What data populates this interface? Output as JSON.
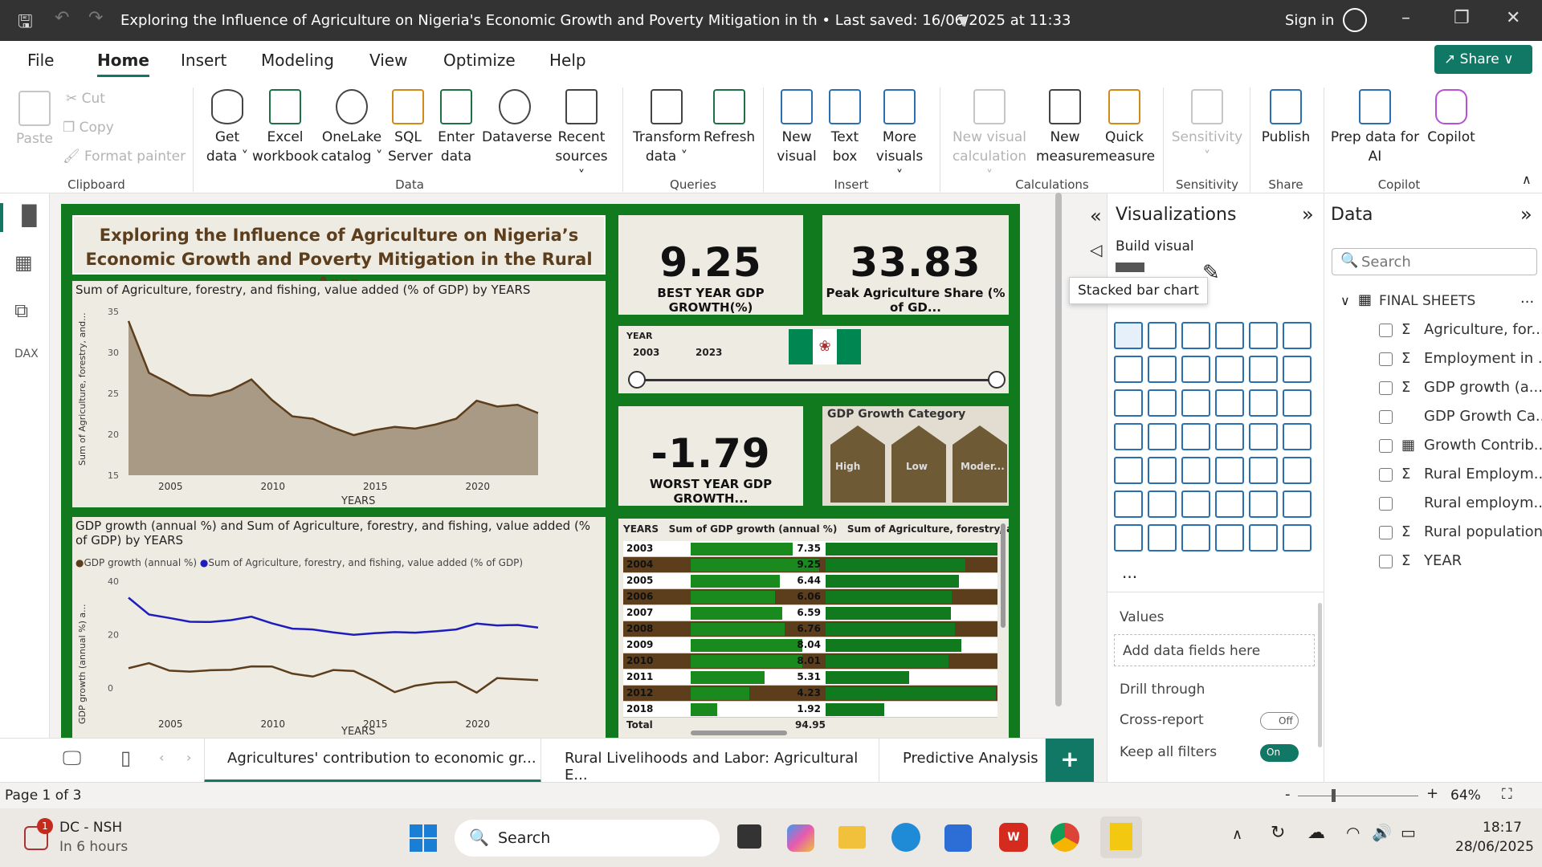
{
  "window": {
    "title": "Exploring the Influence of Agriculture on Nigeria's Economic Growth and Poverty Mitigation in th • Last saved: 16/06/2025 at 11:33",
    "sign_in": "Sign in"
  },
  "menu": {
    "tabs": [
      "File",
      "Home",
      "Insert",
      "Modeling",
      "View",
      "Optimize",
      "Help"
    ],
    "active": "Home",
    "share": "Share"
  },
  "ribbon": {
    "clipboard": {
      "paste": "Paste",
      "cut": "Cut",
      "copy": "Copy",
      "format_painter": "Format painter",
      "group": "Clipboard"
    },
    "data": {
      "get_data": [
        "Get",
        "data ˅"
      ],
      "excel": [
        "Excel",
        "workbook"
      ],
      "onelake": [
        "OneLake",
        "catalog ˅"
      ],
      "sql": [
        "SQL",
        "Server"
      ],
      "enter": [
        "Enter",
        "data"
      ],
      "dataverse": "Dataverse",
      "recent": [
        "Recent",
        "sources ˅"
      ],
      "group": "Data"
    },
    "queries": {
      "transform": [
        "Transform",
        "data ˅"
      ],
      "refresh": "Refresh",
      "group": "Queries"
    },
    "insert": {
      "new_visual": [
        "New",
        "visual"
      ],
      "text_box": [
        "Text",
        "box"
      ],
      "more_visuals": [
        "More",
        "visuals ˅"
      ],
      "group": "Insert"
    },
    "calculations": {
      "new_visual_calc": [
        "New visual",
        "calculation ˅"
      ],
      "new_measure": [
        "New",
        "measure"
      ],
      "quick_measure": [
        "Quick",
        "measure"
      ],
      "group": "Calculations"
    },
    "sensitivity": {
      "label": [
        "Sensitivity",
        "˅"
      ],
      "group": "Sensitivity"
    },
    "share": {
      "publish": "Publish",
      "group": "Share"
    },
    "copilot": {
      "prep": [
        "Prep data for",
        "AI"
      ],
      "copilot": "Copilot",
      "group": "Copilot"
    }
  },
  "report": {
    "title": "Exploring the Influence of Agriculture on Nigeria’s Economic Growth and Poverty Mitigation in the Rural Area",
    "kpi1": {
      "value": "9.25",
      "label": "BEST YEAR GDP GROWTH(%)"
    },
    "kpi2": {
      "value": "33.83",
      "label": "Peak Agriculture Share (% of GD..."
    },
    "kpi3": {
      "value": "-1.79",
      "label": "WORST YEAR GDP GROWTH..."
    },
    "slicer": {
      "label": "YEAR",
      "from": "2003",
      "to": "2023"
    },
    "category": {
      "title": "GDP Growth Category",
      "items": [
        "High",
        "Low",
        "Moder..."
      ]
    }
  },
  "chart_data": [
    {
      "type": "area",
      "title": "Sum of Agriculture, forestry, and fishing, value added (% of GDP) by YEARS",
      "xlabel": "YEARS",
      "ylabel": "Sum of Agriculture, forestry, and...",
      "x": [
        2003,
        2004,
        2005,
        2006,
        2007,
        2008,
        2009,
        2010,
        2011,
        2012,
        2013,
        2014,
        2015,
        2016,
        2017,
        2018,
        2019,
        2020,
        2021,
        2022,
        2023
      ],
      "values": [
        33.83,
        27.5,
        26.2,
        24.8,
        24.7,
        25.4,
        26.7,
        24.2,
        22.2,
        21.9,
        20.8,
        19.9,
        20.5,
        20.9,
        20.7,
        21.2,
        21.9,
        24.1,
        23.4,
        23.6,
        22.6
      ],
      "ylim": [
        15,
        35
      ],
      "yticks": [
        15,
        20,
        25,
        30,
        35
      ],
      "xticks": [
        2005,
        2010,
        2015,
        2020
      ],
      "color": "#5c3e1d",
      "fill": "#a89a85"
    },
    {
      "type": "line",
      "title": "GDP growth (annual %) and Sum of Agriculture, forestry, and fishing, value added (% of GDP) by YEARS",
      "xlabel": "YEARS",
      "ylabel": "GDP growth (annual %) a...",
      "x": [
        2003,
        2004,
        2005,
        2006,
        2007,
        2008,
        2009,
        2010,
        2011,
        2012,
        2013,
        2014,
        2015,
        2016,
        2017,
        2018,
        2019,
        2020,
        2021,
        2022,
        2023
      ],
      "series": [
        {
          "name": "GDP growth (annual %)",
          "color": "#5c3e1d",
          "values": [
            7.35,
            9.25,
            6.44,
            6.06,
            6.59,
            6.76,
            8.04,
            8.01,
            5.31,
            4.23,
            6.67,
            6.31,
            2.65,
            -1.62,
            0.81,
            1.92,
            2.21,
            -1.79,
            3.65,
            3.25,
            2.86
          ]
        },
        {
          "name": "Sum of Agriculture, forestry, and fishing, value added (% of GDP)",
          "color": "#1d1dbd",
          "values": [
            33.83,
            27.5,
            26.2,
            24.8,
            24.7,
            25.4,
            26.7,
            24.2,
            22.2,
            21.9,
            20.8,
            19.9,
            20.5,
            20.9,
            20.7,
            21.2,
            21.9,
            24.1,
            23.4,
            23.6,
            22.6
          ]
        }
      ],
      "ylim": [
        -10,
        40
      ],
      "yticks": [
        0,
        20,
        40
      ],
      "xticks": [
        2005,
        2010,
        2015,
        2020
      ]
    },
    {
      "type": "table",
      "columns": [
        "YEARS",
        "Sum of GDP growth (annual %)",
        "Sum of Agriculture, forestry, and fishing"
      ],
      "rows": [
        {
          "year": "2003",
          "gdp": "7.35",
          "gdp_v": 7.35,
          "agri_v": 33.83
        },
        {
          "year": "2004",
          "gdp": "9.25",
          "gdp_v": 9.25,
          "agri_v": 27.5
        },
        {
          "year": "2005",
          "gdp": "6.44",
          "gdp_v": 6.44,
          "agri_v": 26.2
        },
        {
          "year": "2006",
          "gdp": "6.06",
          "gdp_v": 6.06,
          "agri_v": 24.8
        },
        {
          "year": "2007",
          "gdp": "6.59",
          "gdp_v": 6.59,
          "agri_v": 24.7
        },
        {
          "year": "2008",
          "gdp": "6.76",
          "gdp_v": 6.76,
          "agri_v": 25.4
        },
        {
          "year": "2009",
          "gdp": "8.04",
          "gdp_v": 8.04,
          "agri_v": 26.7
        },
        {
          "year": "2010",
          "gdp": "8.01",
          "gdp_v": 8.01,
          "agri_v": 24.2
        },
        {
          "year": "2011",
          "gdp": "5.31",
          "gdp_v": 5.31,
          "agri_v": 16.4
        },
        {
          "year": "2012",
          "gdp": "4.23",
          "gdp_v": 4.23,
          "agri_v": 33.5
        },
        {
          "year": "2018",
          "gdp": "1.92",
          "gdp_v": 1.92,
          "agri_v": 11.5
        }
      ],
      "total_label": "Total",
      "total": "94.95"
    }
  ],
  "pages": {
    "tabs": [
      "Agricultures' contribution to economic gr...",
      "Rural Livelihoods and Labor: Agricultural E...",
      "Predictive Analysis"
    ],
    "active": 0,
    "add": "+"
  },
  "status": {
    "page": "Page 1 of 3",
    "zoom": "64%",
    "zoom_level": 0.64
  },
  "viz_pane": {
    "title": "Visualizations",
    "build": "Build visual",
    "tooltip": "Stacked bar chart",
    "values": "Values",
    "add_fields": "Add data fields here",
    "drill": "Drill through",
    "cross_report": "Cross-report",
    "cross_state": "Off",
    "keep_filters": "Keep all filters",
    "keep_state": "On",
    "more": "..."
  },
  "data_pane": {
    "title": "Data",
    "search_placeholder": "Search",
    "table": "FINAL SHEETS",
    "more": "...",
    "fields": [
      {
        "sym": "Σ",
        "name": "Agriculture, for..."
      },
      {
        "sym": "Σ",
        "name": "Employment in ..."
      },
      {
        "sym": "Σ",
        "name": "GDP growth (a..."
      },
      {
        "sym": "",
        "name": "GDP Growth Ca..."
      },
      {
        "sym": "▦",
        "name": "Growth Contrib..."
      },
      {
        "sym": "Σ",
        "name": "Rural Employm..."
      },
      {
        "sym": "",
        "name": "Rural employm..."
      },
      {
        "sym": "Σ",
        "name": "Rural population"
      },
      {
        "sym": "Σ",
        "name": "YEAR"
      }
    ]
  },
  "taskbar": {
    "notif_title": "DC - NSH",
    "notif_sub": "In 6 hours",
    "badge": "1",
    "search": "Search",
    "time": "18:17",
    "date": "28/06/2025"
  },
  "colors": {
    "accent": "#117865",
    "canvas": "#117a1e",
    "card": "#eeebe2",
    "brown": "#5c3e1d"
  }
}
